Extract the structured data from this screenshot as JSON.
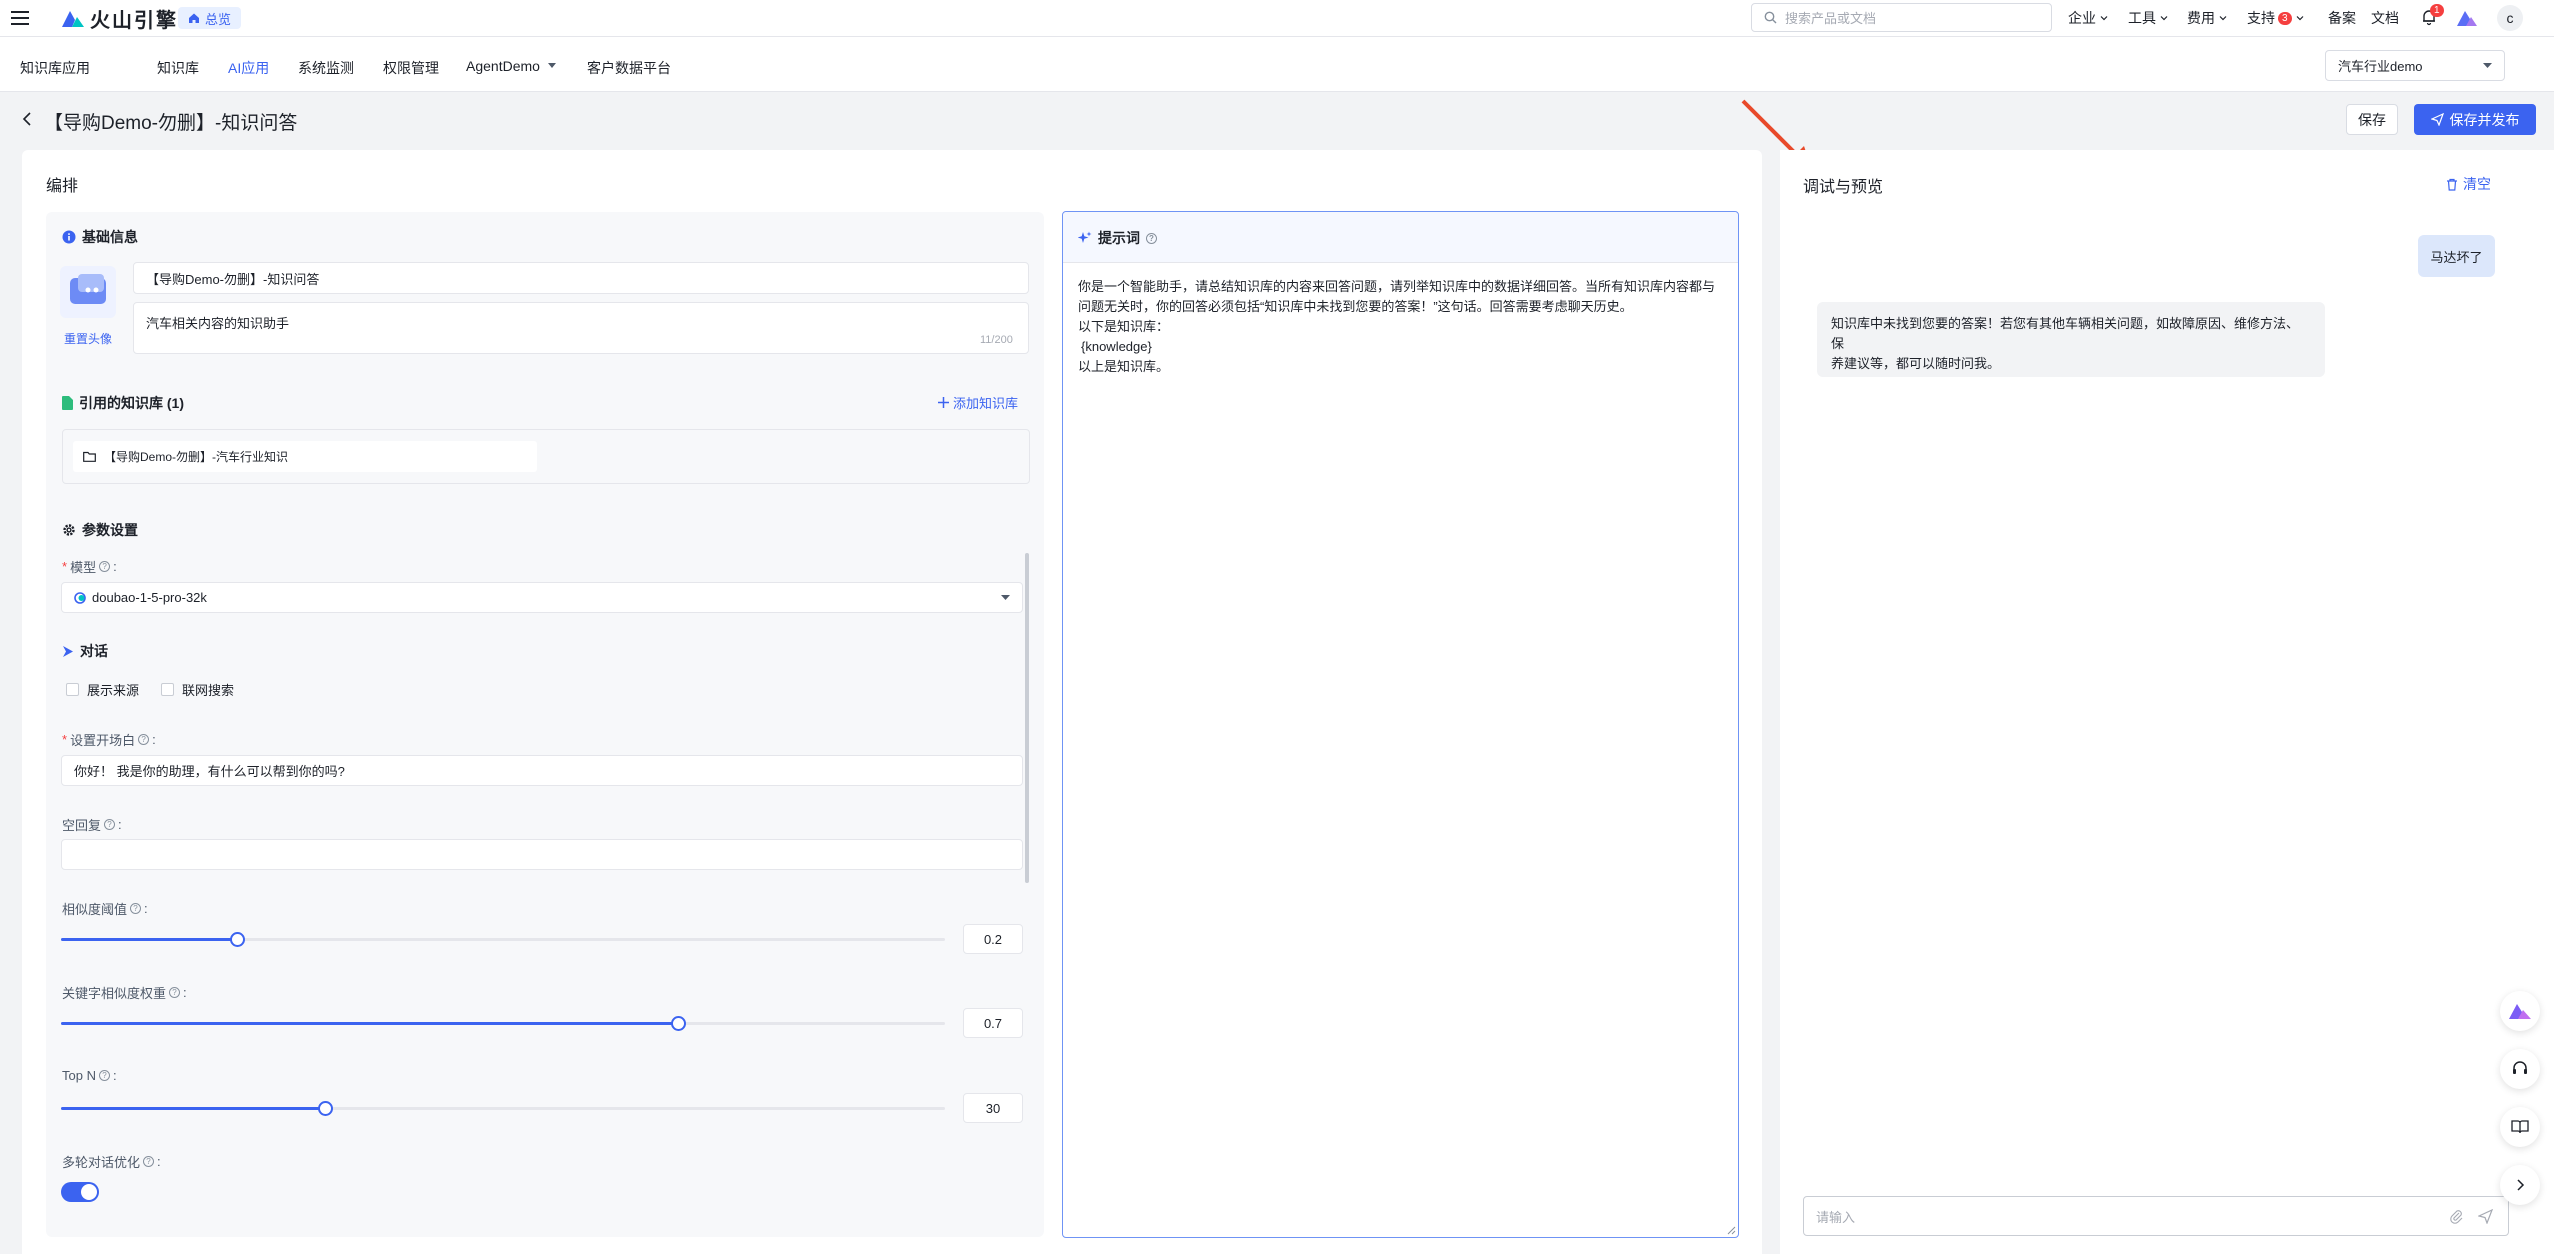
{
  "topbar": {
    "brand": "火山引擎",
    "home": "总览",
    "search_placeholder": "搜索产品或文档",
    "nav": [
      {
        "label": "企业"
      },
      {
        "label": "工具"
      },
      {
        "label": "费用"
      },
      {
        "label": "支持",
        "badge": "3"
      },
      {
        "label": "备案"
      },
      {
        "label": "文档"
      }
    ],
    "bell_badge": "1",
    "user_initial": "c"
  },
  "subbar": {
    "title": "知识库应用",
    "tabs": [
      "知识库",
      "AI应用",
      "系统监测",
      "权限管理",
      "AgentDemo",
      "客户数据平台"
    ],
    "active_tab": "AI应用",
    "space": "汽车行业demo"
  },
  "page": {
    "title": "【导购Demo-勿删】-知识问答",
    "save": "保存",
    "save_publish": "保存并发布"
  },
  "editor": {
    "heading": "编排",
    "basic": {
      "heading": "基础信息",
      "reset_avatar": "重置头像",
      "name": "【导购Demo-勿删】-知识问答",
      "description": "汽车相关内容的知识助手",
      "counter": "11/200"
    },
    "kb": {
      "heading": "引用的知识库 (1)",
      "add": "添加知识库",
      "item": "【导购Demo-勿删】-汽车行业知识"
    },
    "params": {
      "heading": "参数设置",
      "model_label": "模型",
      "model": "doubao-1-5-pro-32k",
      "dialog_heading": "对话",
      "show_source": "展示来源",
      "web_search": "联网搜索",
      "opening_label": "设置开场白",
      "opening": "你好！ 我是你的助理，有什么可以帮到你的吗?",
      "empty_reply_label": "空回复",
      "similarity_label": "相似度阈值",
      "similarity": "0.2",
      "keyword_label": "关键字相似度权重",
      "keyword": "0.7",
      "topn_label": "Top N",
      "topn": "30",
      "multiturn_label": "多轮对话优化",
      "multiturn_on": true
    },
    "prompt": {
      "heading": "提示词",
      "lines": [
        "你是一个智能助手，请总结知识库的内容来回答问题，请列举知识库中的数据详细回答。当所有知识库内容都与",
        "问题无关时，你的回答必须包括“知识库中未找到您要的答案！”这句话。回答需要考虑聊天历史。",
        "以下是知识库：",
        "{knowledge}",
        "以上是知识库。"
      ]
    }
  },
  "debug": {
    "heading": "调试与预览",
    "clear": "清空",
    "user_msg": "马达坏了",
    "bot_msg_lines": [
      "知识库中未找到您要的答案！若您有其他车辆相关问题，如故障原因、维修方法、保",
      "养建议等，都可以随时问我。"
    ],
    "input_placeholder": "请输入"
  },
  "colors": {
    "primary": "#3b63f0",
    "arrow": "#e8492a"
  }
}
